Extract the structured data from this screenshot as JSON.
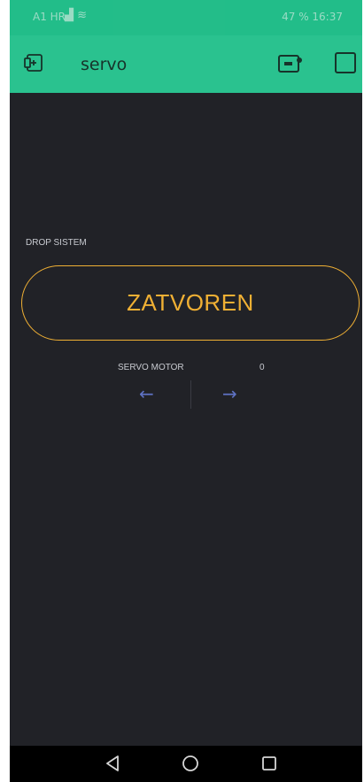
{
  "status_bar": {
    "carrier": "A1 HR",
    "battery_time": "47 % 16:37"
  },
  "header": {
    "project_title": "servo"
  },
  "widgets": {
    "drop_label": "DROP SISTEM",
    "drop_button_text": "ZATVOREN",
    "servo_label": "SERVO MOTOR",
    "servo_value": "0",
    "accent_color": "#f0b034",
    "arrow_color": "#5e72c3"
  },
  "icons": {
    "left_arrow": "arrow-left-icon",
    "right_arrow": "arrow-right-icon",
    "back": "back-triangle-icon",
    "home": "home-circle-icon",
    "recents": "recents-square-icon"
  }
}
